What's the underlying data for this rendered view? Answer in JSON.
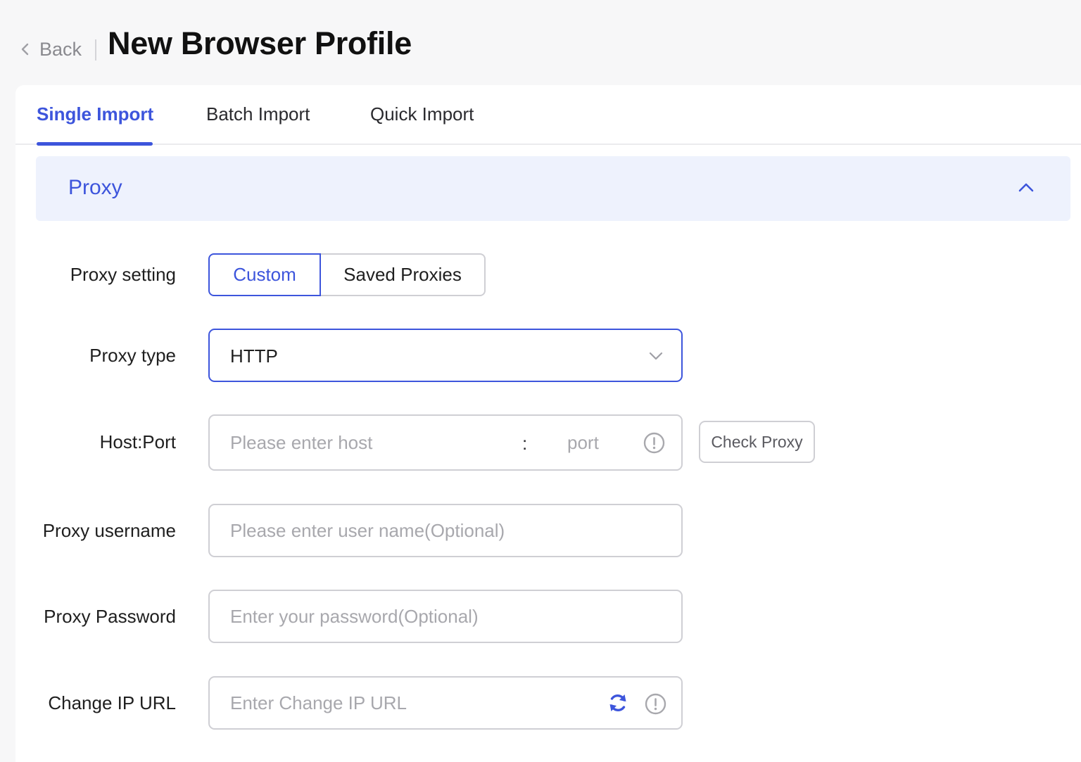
{
  "header": {
    "back_label": "Back",
    "title": "New Browser Profile"
  },
  "tabs": [
    {
      "label": "Single Import",
      "active": true
    },
    {
      "label": "Batch Import",
      "active": false
    },
    {
      "label": "Quick Import",
      "active": false
    }
  ],
  "section": {
    "title": "Proxy",
    "expanded": true
  },
  "form": {
    "proxy_setting": {
      "label": "Proxy setting",
      "options": [
        "Custom",
        "Saved Proxies"
      ],
      "selected": "Custom"
    },
    "proxy_type": {
      "label": "Proxy type",
      "value": "HTTP"
    },
    "host_port": {
      "label": "Host:Port",
      "host_placeholder": "Please enter host",
      "separator": ":",
      "port_placeholder": "port",
      "check_button": "Check Proxy"
    },
    "username": {
      "label": "Proxy username",
      "placeholder": "Please enter user name(Optional)"
    },
    "password": {
      "label": "Proxy Password",
      "placeholder": "Enter your password(Optional)"
    },
    "change_ip_url": {
      "label": "Change IP URL",
      "placeholder": "Enter Change IP URL"
    }
  },
  "colors": {
    "accent": "#3d55dc",
    "section_bg": "#eef2fd",
    "border": "#cfcfd4",
    "placeholder": "#a8a8ad"
  },
  "icons": {
    "back": "chevron-left-icon",
    "collapse": "chevron-up-icon",
    "select": "chevron-down-icon",
    "info": "info-icon",
    "refresh": "refresh-icon"
  }
}
